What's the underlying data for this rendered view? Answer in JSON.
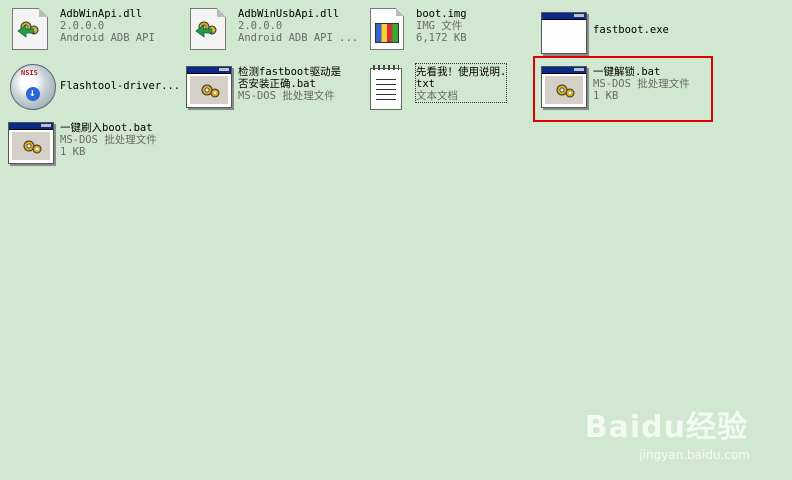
{
  "files": [
    {
      "name": "AdbWinApi.dll",
      "line2": "2.0.0.0",
      "line3": "Android ADB API",
      "icon": "dll-icon"
    },
    {
      "name": "AdbWinUsbApi.dll",
      "line2": "2.0.0.0",
      "line3": "Android ADB API ...",
      "icon": "dll-icon"
    },
    {
      "name": "boot.img",
      "line2": "IMG 文件",
      "line3": "6,172 KB",
      "icon": "img-file-icon"
    },
    {
      "name": "fastboot.exe",
      "icon": "exe-window-icon"
    },
    {
      "name": "Flashtool-driver...",
      "icon": "nsis-installer-icon"
    },
    {
      "name_line1": "检测fastboot驱动是",
      "name_line2": "否安装正确.bat",
      "line3": "MS-DOS 批处理文件",
      "icon": "batch-file-icon"
    },
    {
      "name_line1": "先看我！使用说明.",
      "name_line2": "txt",
      "line3": "文本文档",
      "icon": "text-document-icon"
    },
    {
      "name": "一键解锁.bat",
      "line2": "MS-DOS 批处理文件",
      "line3": "1 KB",
      "icon": "batch-file-icon",
      "selected": true
    },
    {
      "name": "一键刷入boot.bat",
      "line2": "MS-DOS 批处理文件",
      "line3": "1 KB",
      "icon": "batch-file-icon"
    }
  ],
  "watermark": {
    "logo": "Baidu经验",
    "url": "jingyan.baidu.com"
  },
  "colors": {
    "background": "#cfe8cf",
    "selection_border": "#e00000"
  }
}
